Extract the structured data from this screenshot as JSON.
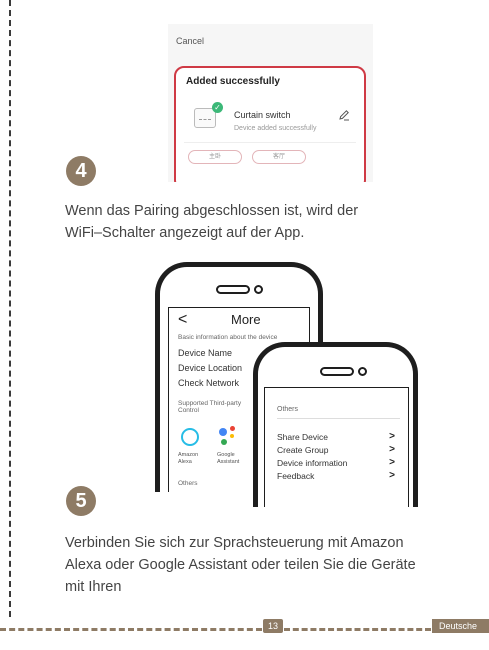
{
  "screenshot": {
    "cancel": "Cancel",
    "title": "Added successfully",
    "device_name": "Curtain switch",
    "device_status": "Device added successfully",
    "rooms": [
      "主卧",
      "客厅"
    ],
    "check_icon": "check-icon",
    "edit_icon": "pencil-icon",
    "border_color": "#cf3a45"
  },
  "steps": {
    "step4": {
      "number": "4",
      "text_line1": "Wenn das Pairing abgeschlossen ist, wird der",
      "text_line2": "WiFi–Schalter angezeigt auf der App."
    },
    "step5": {
      "number": "5",
      "text_line1": "Verbinden Sie sich zur Sprachsteuerung mit Amazon",
      "text_line2": "Alexa oder Google Assistant oder teilen Sie die Geräte",
      "text_line3": "mit Ihren"
    }
  },
  "phone_back": {
    "back_glyph": "<",
    "title": "More",
    "basic_info_header": "Basic information about the device",
    "items": [
      "Device Name",
      "Device Location",
      "Check Network"
    ],
    "third_party_header_line1": "Supported Third-party",
    "third_party_header_line2": "Control",
    "alexa_line1": "Amazon",
    "alexa_line2": "Alexa",
    "google_line1": "Google",
    "google_line2": "Assistant",
    "others": "Others"
  },
  "phone_front": {
    "others": "Others",
    "items": [
      {
        "label": "Share Device",
        "arrow": ">"
      },
      {
        "label": "Create Group",
        "arrow": ">"
      },
      {
        "label": "Device information",
        "arrow": ">"
      },
      {
        "label": "Feedback",
        "arrow": ">"
      }
    ]
  },
  "footer": {
    "page_number": "13",
    "language": "Deutsche"
  },
  "colors": {
    "accent": "#8e7b65",
    "alexa": "#27bde6"
  }
}
